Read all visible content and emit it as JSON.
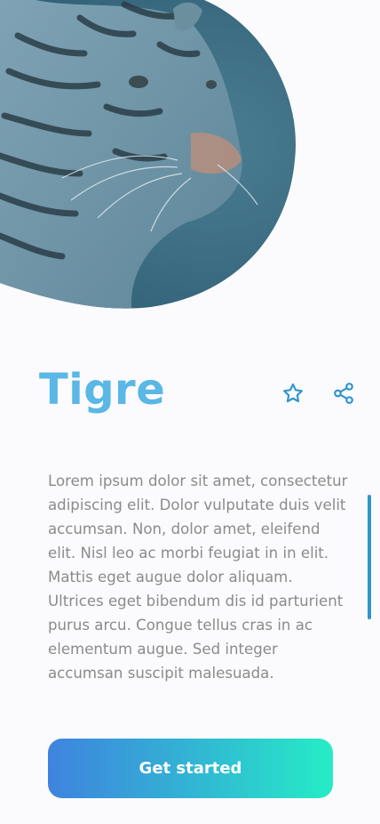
{
  "hero": {
    "image_subject": "tiger portrait",
    "tint_color": "#3f7088"
  },
  "animal": {
    "name": "Tigre",
    "description": "Lorem ipsum dolor sit amet, consectetur adipiscing elit. Dolor vulputate duis velit accumsan. Non, dolor amet, eleifend elit. Nisl leo ac morbi feugiat in in elit. Mattis eget augue dolor aliquam. Ultrices eget bibendum dis id parturient purus arcu. Congue tellus cras in ac elementum augue. Sed integer accumsan suscipit malesuada."
  },
  "actions": {
    "favorite_icon": "star-icon",
    "share_icon": "share-icon"
  },
  "cta": {
    "label": "Get started"
  },
  "colors": {
    "accent": "#5ab7e6",
    "icon": "#2f95cf",
    "gradient_start": "#3f83de",
    "gradient_end": "#26ecc6"
  }
}
